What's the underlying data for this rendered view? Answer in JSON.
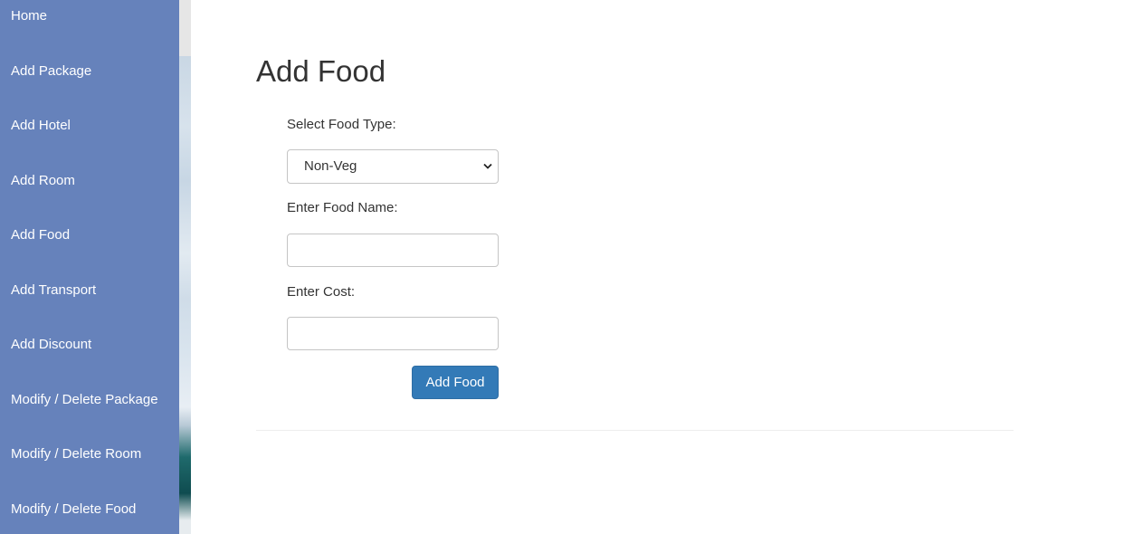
{
  "sidebar": {
    "items": [
      {
        "label": "Home"
      },
      {
        "label": "Add Package"
      },
      {
        "label": "Add Hotel"
      },
      {
        "label": "Add Room"
      },
      {
        "label": "Add Food"
      },
      {
        "label": "Add Transport"
      },
      {
        "label": "Add Discount"
      },
      {
        "label": "Modify / Delete Package"
      },
      {
        "label": "Modify / Delete Room"
      },
      {
        "label": "Modify / Delete Food"
      }
    ]
  },
  "main": {
    "title": "Add Food",
    "form": {
      "food_type_label": "Select Food Type:",
      "food_type_value": "Non-Veg",
      "food_name_label": "Enter Food Name:",
      "food_name_value": "",
      "cost_label": "Enter Cost:",
      "cost_value": "",
      "submit_label": "Add Food"
    }
  },
  "colors": {
    "sidebar_bg": "#6682bb",
    "button_bg": "#337ab7"
  },
  "icons": {
    "select_arrow": "chevron-down-icon"
  }
}
